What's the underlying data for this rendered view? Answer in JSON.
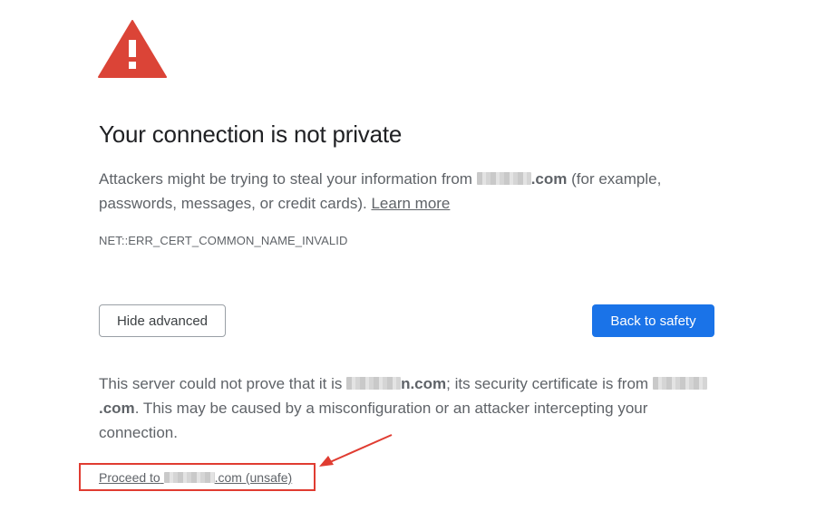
{
  "page": {
    "icon": "warning-triangle-icon",
    "title": "Your connection is not private",
    "message": {
      "part1": "Attackers might be trying to steal your information from",
      "domain": ".com",
      "part2": "(for example, passwords, messages, or credit cards).",
      "learn_more": "Learn more"
    },
    "error_code": "NET::ERR_CERT_COMMON_NAME_INVALID"
  },
  "buttons": {
    "hide_advanced": "Hide advanced",
    "back_to_safety": "Back to safety"
  },
  "advanced": {
    "part1": "This server could not prove that it is",
    "domain1": "n.com",
    "part2": "; its security certificate is from",
    "domain2": ".com",
    "part3": ". This may be caused by a misconfiguration or an attacker intercepting your connection.",
    "proceed_prefix": "Proceed to",
    "proceed_suffix": ".com (unsafe)"
  },
  "colors": {
    "warning_red": "#db4437",
    "primary_blue": "#1a73e8",
    "annotation_red": "#e03c31"
  }
}
